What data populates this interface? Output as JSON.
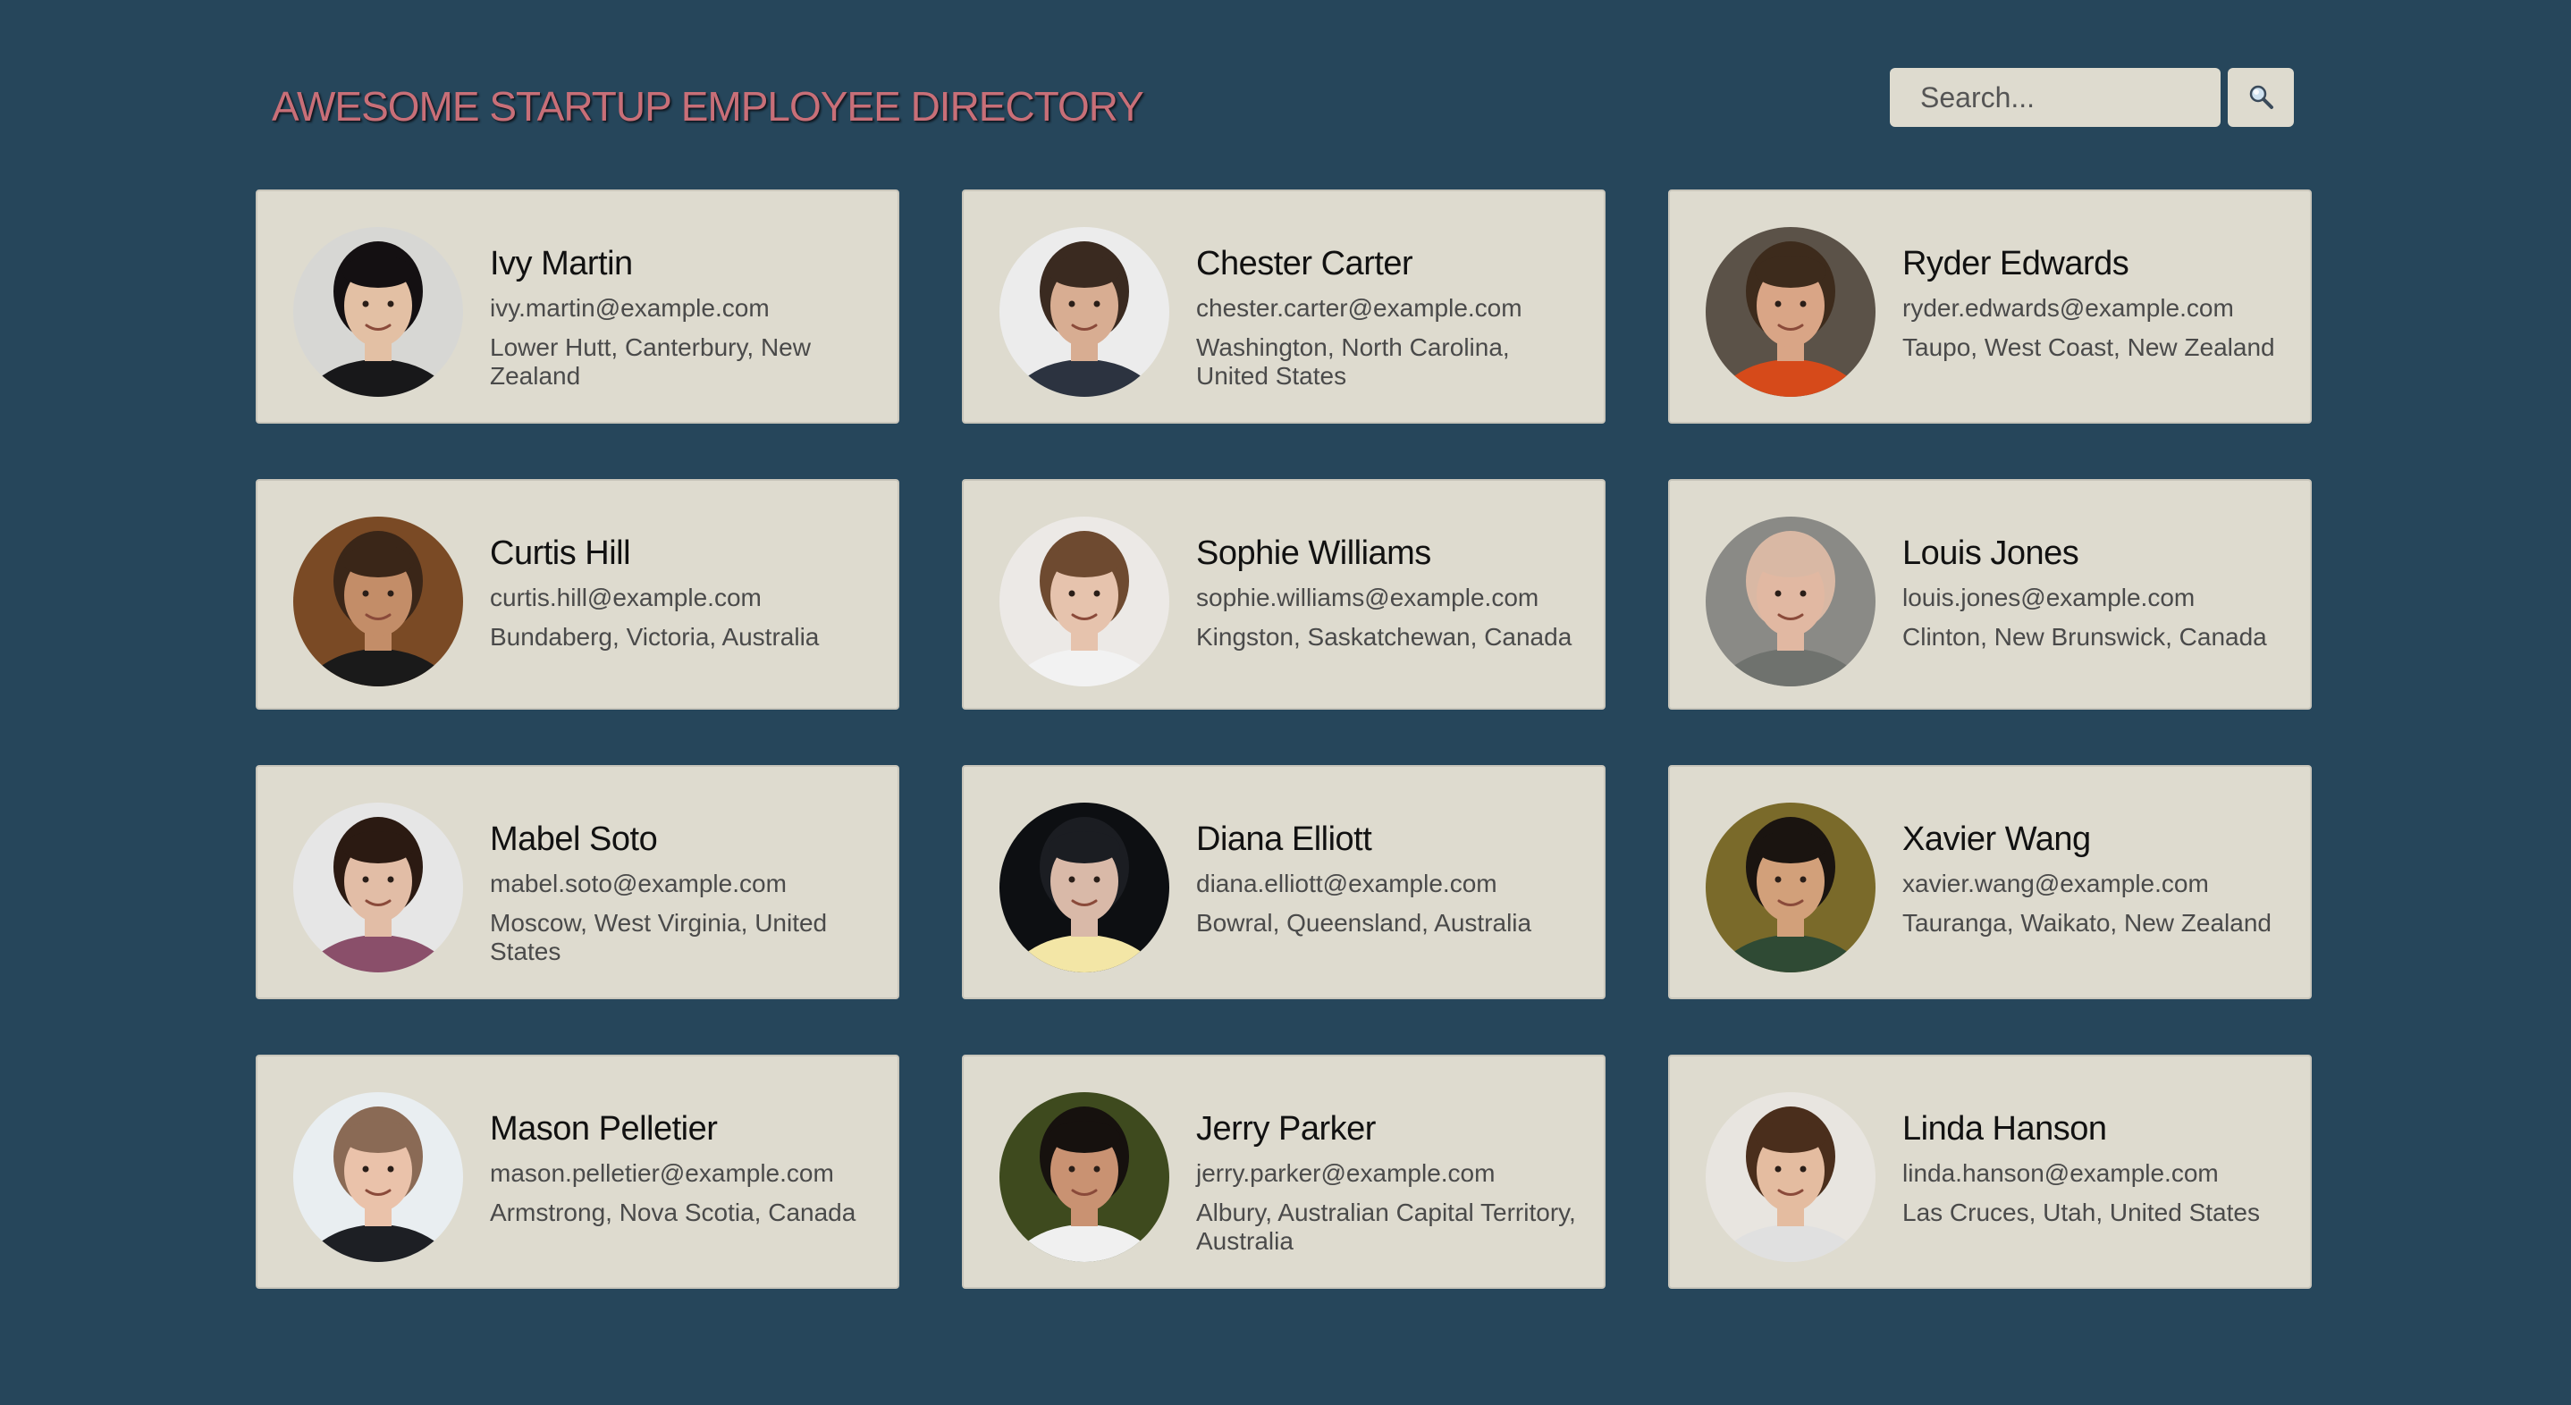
{
  "header": {
    "title": "AWESOME STARTUP EMPLOYEE DIRECTORY"
  },
  "search": {
    "placeholder": "Search...",
    "value": "",
    "button_icon": "magnifier-icon"
  },
  "employees": [
    {
      "name": "Ivy Martin",
      "email": "ivy.martin@example.com",
      "location": "Lower Hutt, Canterbury, New Zealand",
      "avatar": {
        "bg": "#d7d7d4",
        "skin": "#e3c0a4",
        "hair": "#141012",
        "shirt": "#18181a"
      }
    },
    {
      "name": "Chester Carter",
      "email": "chester.carter@example.com",
      "location": "Washington, North Carolina, United States",
      "avatar": {
        "bg": "#ececec",
        "skin": "#d8ad92",
        "hair": "#3a2a20",
        "shirt": "#2c3340"
      }
    },
    {
      "name": "Ryder Edwards",
      "email": "ryder.edwards@example.com",
      "location": "Taupo, West Coast, New Zealand",
      "avatar": {
        "bg": "#5b5248",
        "skin": "#d9a586",
        "hair": "#3d2b1c",
        "shirt": "#d64a1a"
      }
    },
    {
      "name": "Curtis Hill",
      "email": "curtis.hill@example.com",
      "location": "Bundaberg, Victoria, Australia",
      "avatar": {
        "bg": "#7a4a25",
        "skin": "#c38d68",
        "hair": "#3a2618",
        "shirt": "#1a1a1a"
      }
    },
    {
      "name": "Sophie Williams",
      "email": "sophie.williams@example.com",
      "location": "Kingston, Saskatchewan, Canada",
      "avatar": {
        "bg": "#ece9e6",
        "skin": "#e6c3ad",
        "hair": "#6e4a30",
        "shirt": "#f2f2f2"
      }
    },
    {
      "name": "Louis Jones",
      "email": "louis.jones@example.com",
      "location": "Clinton, New Brunswick, Canada",
      "avatar": {
        "bg": "#8a8a86",
        "skin": "#e1b8a2",
        "hair": "#d9b8a4",
        "shirt": "#6f726e"
      }
    },
    {
      "name": "Mabel Soto",
      "email": "mabel.soto@example.com",
      "location": "Moscow, West Virginia, United States",
      "avatar": {
        "bg": "#e6e6e6",
        "skin": "#e2bda6",
        "hair": "#2b1a12",
        "shirt": "#8a4f6a"
      }
    },
    {
      "name": "Diana Elliott",
      "email": "diana.elliott@example.com",
      "location": "Bowral, Queensland, Australia",
      "avatar": {
        "bg": "#0d0f12",
        "skin": "#d9b9a8",
        "hair": "#1b1d22",
        "shirt": "#f3e6a6"
      }
    },
    {
      "name": "Xavier Wang",
      "email": "xavier.wang@example.com",
      "location": "Tauranga, Waikato, New Zealand",
      "avatar": {
        "bg": "#7a6a2a",
        "skin": "#d2a07a",
        "hair": "#1a1410",
        "shirt": "#2f4a34"
      }
    },
    {
      "name": "Mason Pelletier",
      "email": "mason.pelletier@example.com",
      "location": "Armstrong, Nova Scotia, Canada",
      "avatar": {
        "bg": "#e9eef1",
        "skin": "#eac2aa",
        "hair": "#8a6a55",
        "shirt": "#1d1f24"
      }
    },
    {
      "name": "Jerry Parker",
      "email": "jerry.parker@example.com",
      "location": "Albury, Australian Capital Territory, Australia",
      "avatar": {
        "bg": "#3e4a1e",
        "skin": "#c99272",
        "hair": "#16110e",
        "shirt": "#f0f0f0"
      }
    },
    {
      "name": "Linda Hanson",
      "email": "linda.hanson@example.com",
      "location": "Las Cruces, Utah, United States",
      "avatar": {
        "bg": "#e8e5e0",
        "skin": "#e4bca0",
        "hair": "#4a2e1c",
        "shirt": "#e0e0e0"
      }
    }
  ]
}
